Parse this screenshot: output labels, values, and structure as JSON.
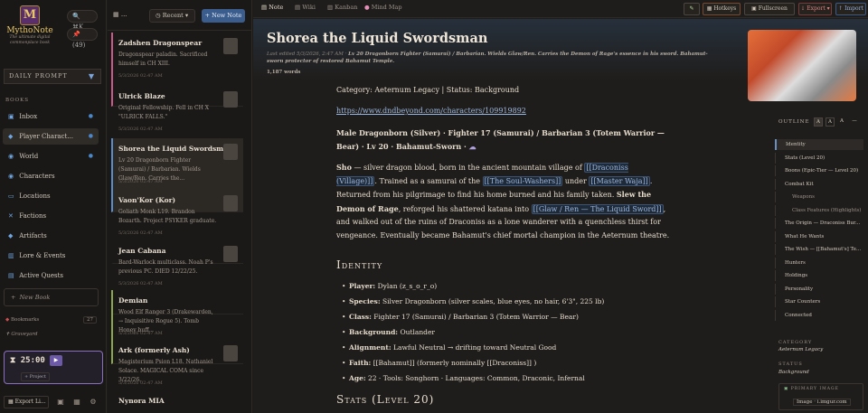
{
  "app": {
    "name": "MythoNote",
    "tagline": "The ultimate digital commonplace book"
  },
  "sidebar": {
    "search_hint": "⌘K",
    "pin_count": "(49)",
    "daily_prompt": "DAILY PROMPT",
    "books_label": "BOOKS",
    "items": [
      {
        "label": "Inbox",
        "icon": "📥"
      },
      {
        "label": "Player Charact...",
        "icon": "🛡"
      },
      {
        "label": "World",
        "icon": "🌍"
      },
      {
        "label": "Characters",
        "icon": "👥"
      },
      {
        "label": "Locations",
        "icon": "🗺"
      },
      {
        "label": "Factions",
        "icon": "⚔"
      },
      {
        "label": "Artifacts",
        "icon": "💎"
      },
      {
        "label": "Lore & Events",
        "icon": "📚"
      },
      {
        "label": "Active Quests",
        "icon": "📜"
      }
    ],
    "new_book": "New Book",
    "bookmarks": "Bookmarks",
    "bookmarks_count": "27",
    "graveyard": "Graveyard",
    "timer": "25:00",
    "project": "+ Project",
    "export": "Export Li..."
  },
  "list": {
    "sort": "Recent",
    "new_note": "+ New Note",
    "notes": [
      {
        "title": "Zadshen Dragonspear",
        "desc": "Dragonspear paladin. Sacrificed himself in CH XIII.",
        "date": "5/3/2026 02:47 AM"
      },
      {
        "title": "Ulrick Blaze",
        "desc": "Original Fellowship. Fell in CH X \"ULRICK FALLS.\"",
        "date": "5/3/2026 02:47 AM"
      },
      {
        "title": "Shorea the Liquid Swordsman",
        "desc": "Lv 20 Dragonborn Fighter (Samurai) / Barbarian. Wields Glaw/Ren. Carries the...",
        "date": "5/3/2026 02:47 AM"
      },
      {
        "title": "Vaon'Kor (Kor)",
        "desc": "Goliath Monk L19. Brandon Bozarth. Project PSYKER graduate.",
        "date": "5/3/2026 02:47 AM"
      },
      {
        "title": "Jean Cabana",
        "desc": "Bard-Warlock multiclass. Noah P's previous PC. DIED 12/22/25.",
        "date": "5/3/2026 02:47 AM"
      },
      {
        "title": "Demian",
        "desc": "Wood Elf Ranger 3 (Drakewarden, → Inquisitive Rogue 5). Tomb Honey buff...",
        "date": "5/3/2026 02:47 AM"
      },
      {
        "title": "Ark (formerly Ash)",
        "desc": "Magisterium Psion L18. Nathaniel Solace. MAGICAL COMA since 3/22/26.",
        "date": "5/3/2026 02:47 AM"
      },
      {
        "title": "Nynora MIA",
        "desc": "",
        "date": ""
      }
    ]
  },
  "tabs": [
    "Note",
    "Wiki",
    "Kanban",
    "Mind Map"
  ],
  "toolbar": {
    "hotkeys": "Hotkeys",
    "fullscreen": "Fullscreen",
    "export": "Export",
    "import": "Import"
  },
  "note": {
    "title": "Shorea the Liquid Swordsman",
    "last_edited": "Last edited 5/3/2026, 2:47 AM",
    "summary": "Lv 20 Dragonborn Fighter (Samurai) / Barbarian. Wields Glaw/Ren. Carries the Demon of Rage's essence in his sword. Bahamut-sworn protector of restored Bahamut Temple.",
    "words": "1,187 words",
    "category_line": "Category: Aeternum Legacy | Status: Background",
    "url": "https://www.dndbeyond.com/characters/109919892",
    "class_line": "Male Dragonborn (Silver) · Fighter 17 (Samurai) / Barbarian 3 (Totem Warrior — Bear) · Lv 20 · Bahamut-Sworn ·",
    "bio": {
      "a": "Sho",
      "b": " — silver dragon blood, born in the ancient mountain village of ",
      "c": "[[Draconiss (Village)]]",
      "d": ". Trained as a samurai of the ",
      "e": "[[The Soul-Washers]]",
      "f": " under ",
      "g": "[[Master Waja]]",
      "h": ". Returned from his pilgrimage to find his home burned and his family taken. ",
      "i": "Slew the Demon of Rage",
      "j": ", reforged his shattered katana into ",
      "k": "[[Glaw / Ren — The Liquid Sword]]",
      "l": ", and walked out of the ruins of Draconiss as a lone wanderer with a quenchless thirst for vengeance. Eventually became Bahamut's chief mortal champion in the Aeternum theatre."
    },
    "identity_heading": "Identity",
    "identity": [
      {
        "k": "Player:",
        "v": " Dylan (z_s_o_r_o)"
      },
      {
        "k": "Species:",
        "v": " Silver Dragonborn (silver scales, blue eyes, no hair, 6'3\", 225 lb)"
      },
      {
        "k": "Class:",
        "v": " Fighter 17 (Samurai) / Barbarian 3 (Totem Warrior — Bear)"
      },
      {
        "k": "Background:",
        "v": " Outlander"
      },
      {
        "k": "Alignment:",
        "v": " Lawful Neutral → drifting toward Neutral Good"
      },
      {
        "k": "Faith:",
        "v": " [[Bahamut]] (formerly nominally [[Draconiss]] )"
      },
      {
        "k": "Age:",
        "v": " 22 · Tools: Songhorn · Languages: Common, Draconic, Infernal"
      }
    ],
    "stats_heading": "Stats (Level 20)"
  },
  "outline": {
    "label": "OUTLINE",
    "items": [
      {
        "label": "Identity",
        "sub": false
      },
      {
        "label": "Stats (Level 20)",
        "sub": false
      },
      {
        "label": "Boons (Epic-Tier — Level 20)",
        "sub": false
      },
      {
        "label": "Combat Kit",
        "sub": false
      },
      {
        "label": "Weapons",
        "sub": true
      },
      {
        "label": "Class Features (Highlights)",
        "sub": true
      },
      {
        "label": "The Origin — Draconiss Bur...",
        "sub": false
      },
      {
        "label": "What He Wants",
        "sub": false
      },
      {
        "label": "The Wish — [[Bahamut's] Te...",
        "sub": false
      },
      {
        "label": "Hunters",
        "sub": false
      },
      {
        "label": "Holdings",
        "sub": false
      },
      {
        "label": "Personality",
        "sub": false
      },
      {
        "label": "Star Counters",
        "sub": false
      },
      {
        "label": "Connected",
        "sub": false
      }
    ],
    "category_label": "CATEGORY",
    "category": "Aeternum Legacy",
    "status_label": "STATUS",
    "status": "Background",
    "primary_label": "PRIMARY IMAGE",
    "primary_value": "Image · i.imgur.com"
  }
}
